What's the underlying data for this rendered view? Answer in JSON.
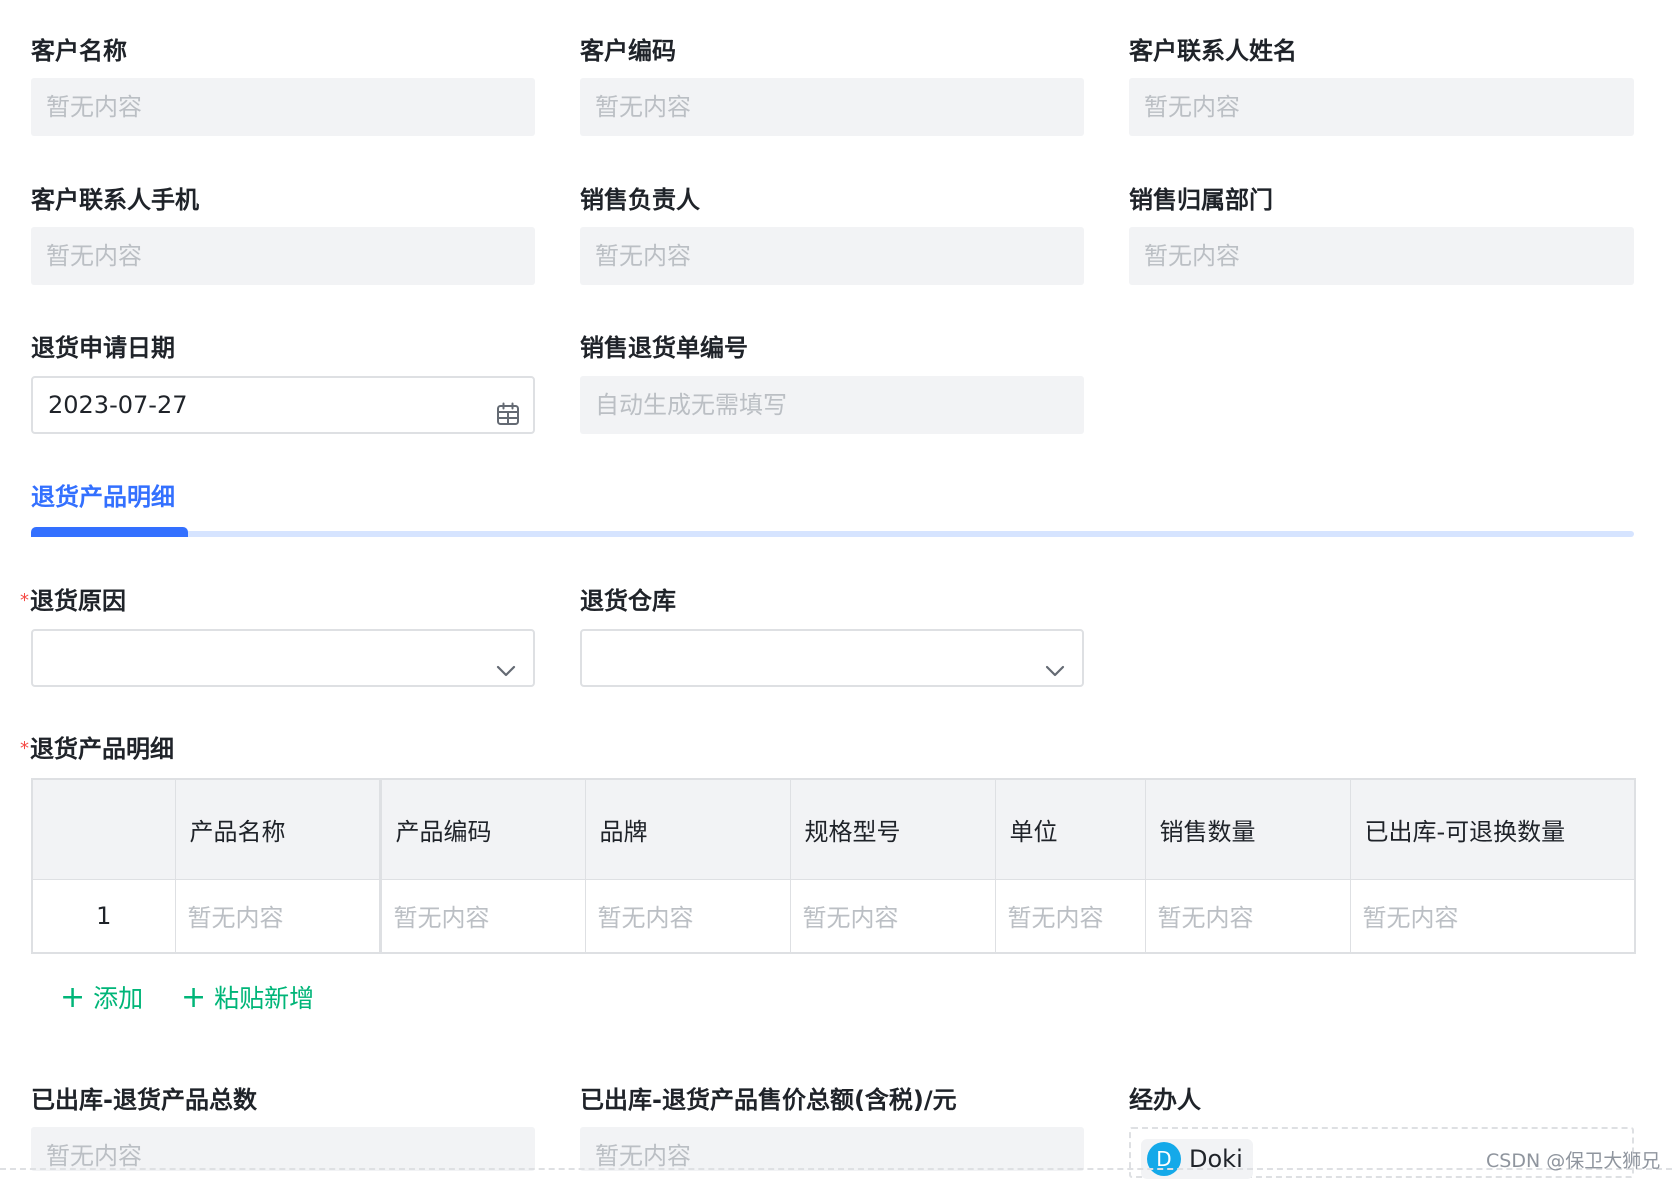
{
  "row1": {
    "customer_name": {
      "label": "客户名称",
      "value": "暂无内容"
    },
    "customer_code": {
      "label": "客户编码",
      "value": "暂无内容"
    },
    "contact_name": {
      "label": "客户联系人姓名",
      "value": "暂无内容"
    }
  },
  "row2": {
    "contact_phone": {
      "label": "客户联系人手机",
      "value": "暂无内容"
    },
    "sales_owner": {
      "label": "销售负责人",
      "value": "暂无内容"
    },
    "sales_dept": {
      "label": "销售归属部门",
      "value": "暂无内容"
    }
  },
  "row3": {
    "return_date": {
      "label": "退货申请日期",
      "value": "2023-07-27"
    },
    "return_no": {
      "label": "销售退货单编号",
      "value": "自动生成无需填写"
    }
  },
  "tab": {
    "title": "退货产品明细"
  },
  "row4": {
    "reason": {
      "required_mark": "*",
      "label": "退货原因",
      "value": ""
    },
    "warehouse": {
      "label": "退货仓库",
      "value": ""
    }
  },
  "details": {
    "required_mark": "*",
    "label": "退货产品明细",
    "columns": [
      "",
      "产品名称",
      "产品编码",
      "品牌",
      "规格型号",
      "单位",
      "销售数量",
      "已出库-可退换数量"
    ],
    "rows": [
      {
        "index": "1",
        "cells": [
          "暂无内容",
          "暂无内容",
          "暂无内容",
          "暂无内容",
          "暂无内容",
          "暂无内容",
          "暂无内容"
        ]
      }
    ],
    "add_label": "添加",
    "paste_label": "粘贴新增"
  },
  "row5": {
    "total_qty": {
      "label": "已出库-退货产品总数",
      "value": "暂无内容"
    },
    "total_amount": {
      "label": "已出库-退货产品售价总额(含税)/元",
      "value": "暂无内容"
    },
    "handler": {
      "label": "经办人",
      "avatar_letter": "D",
      "name": "Doki"
    }
  },
  "watermark": "CSDN @保卫大狮兄",
  "colors": {
    "accent": "#3370ff",
    "action": "#00b578",
    "required": "#f54a45",
    "avatar": "#14a9e9"
  },
  "icons": [
    "calendar-icon",
    "chevron-down-icon",
    "plus-icon"
  ]
}
